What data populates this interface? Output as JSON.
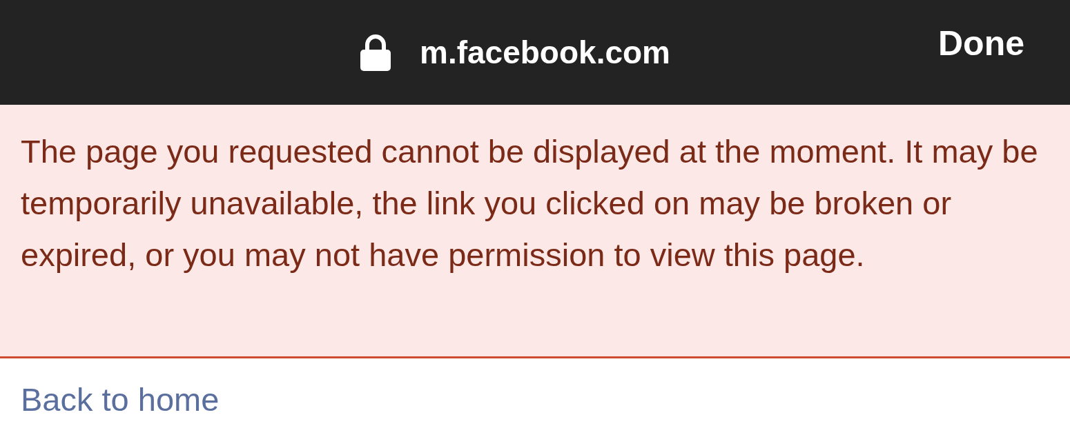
{
  "top_bar": {
    "url": "m.facebook.com",
    "secure": true,
    "done_button": "Done"
  },
  "error_banner": {
    "message": "The page you requested cannot be displayed at the moment. It may be temporarily unavailable, the link you clicked on may be broken or expired, or you may not have permission to view this page."
  },
  "back_link": "Back to home"
}
